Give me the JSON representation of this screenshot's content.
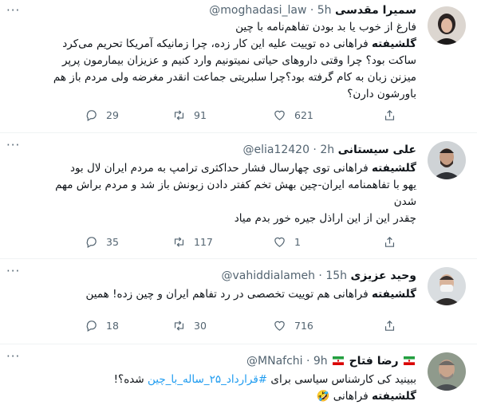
{
  "tweets": [
    {
      "name": "سمیرا مقدسی",
      "meta": "@moghadasi_law · 5h",
      "lines": [
        {
          "text": "فارغ از خوب یا بد بودن تفاهم‌نامه با چین"
        },
        {
          "bold": "گلشیفته",
          "text": " فراهانی ده توییت علیه این کار زده، چرا زمانیکه آمریکا تحریم می‌کرد"
        },
        {
          "text": "ساکت بود؟ چرا وقتی داروهای حیاتی نمیتونیم وارد کنیم و عزیزان بیمارمون پرپر"
        },
        {
          "text": "میزنن زبان به کام گرفته بود؟چرا سلبریتی جماعت انقدر مغرضه ولی مردم باز هم"
        },
        {
          "text": "باورشون دارن؟"
        }
      ],
      "replies": "29",
      "retweets": "91",
      "likes": "621"
    },
    {
      "name": "علی سیستانی",
      "meta": "@elia12420 · 2h",
      "lines": [
        {
          "bold": "گلشیفته",
          "text": " فراهانی توی چهارسال فشار حداکثری ترامپ به مردم ایران لال بود"
        },
        {
          "text": "یهو با تفاهمنامه ایران-چین بهش تخم کفتر دادن زبونش باز شد و مردم براش مهم"
        },
        {
          "text": "شدن"
        },
        {
          "text": "چقدر این از این اراذل جیره خور بدم میاد"
        }
      ],
      "replies": "35",
      "retweets": "117",
      "likes": "1"
    },
    {
      "name": "وحید عزیزی",
      "meta": "@vahiddialameh · 15h",
      "lines": [
        {
          "bold": "گلشیفته",
          "text": " فراهانی هم توییت تخصصی در رد تفاهم ایران و چین زده! همین"
        }
      ],
      "replies": "18",
      "retweets": "30",
      "likes": "716"
    },
    {
      "name": "رضا فتاح",
      "meta": "@MNafchi · 9h",
      "lines": [
        {
          "text": "ببینید کی کارشناس سیاسی برای ",
          "link": "#قرارداد_۲۵_ساله_با_چین",
          "after": " شده؟!"
        },
        {
          "bold": "گلشیفته",
          "text": " فراهانی 🤣"
        }
      ],
      "replies": "",
      "retweets": "",
      "likes": ""
    }
  ],
  "icons": [
    "more-icon",
    "reply-icon",
    "retweet-icon",
    "like-icon",
    "share-icon",
    "iran-flag-icon"
  ],
  "colors": {
    "accent": "#1d9bf0",
    "secondary_text": "#536471",
    "divider": "#eff3f4"
  }
}
